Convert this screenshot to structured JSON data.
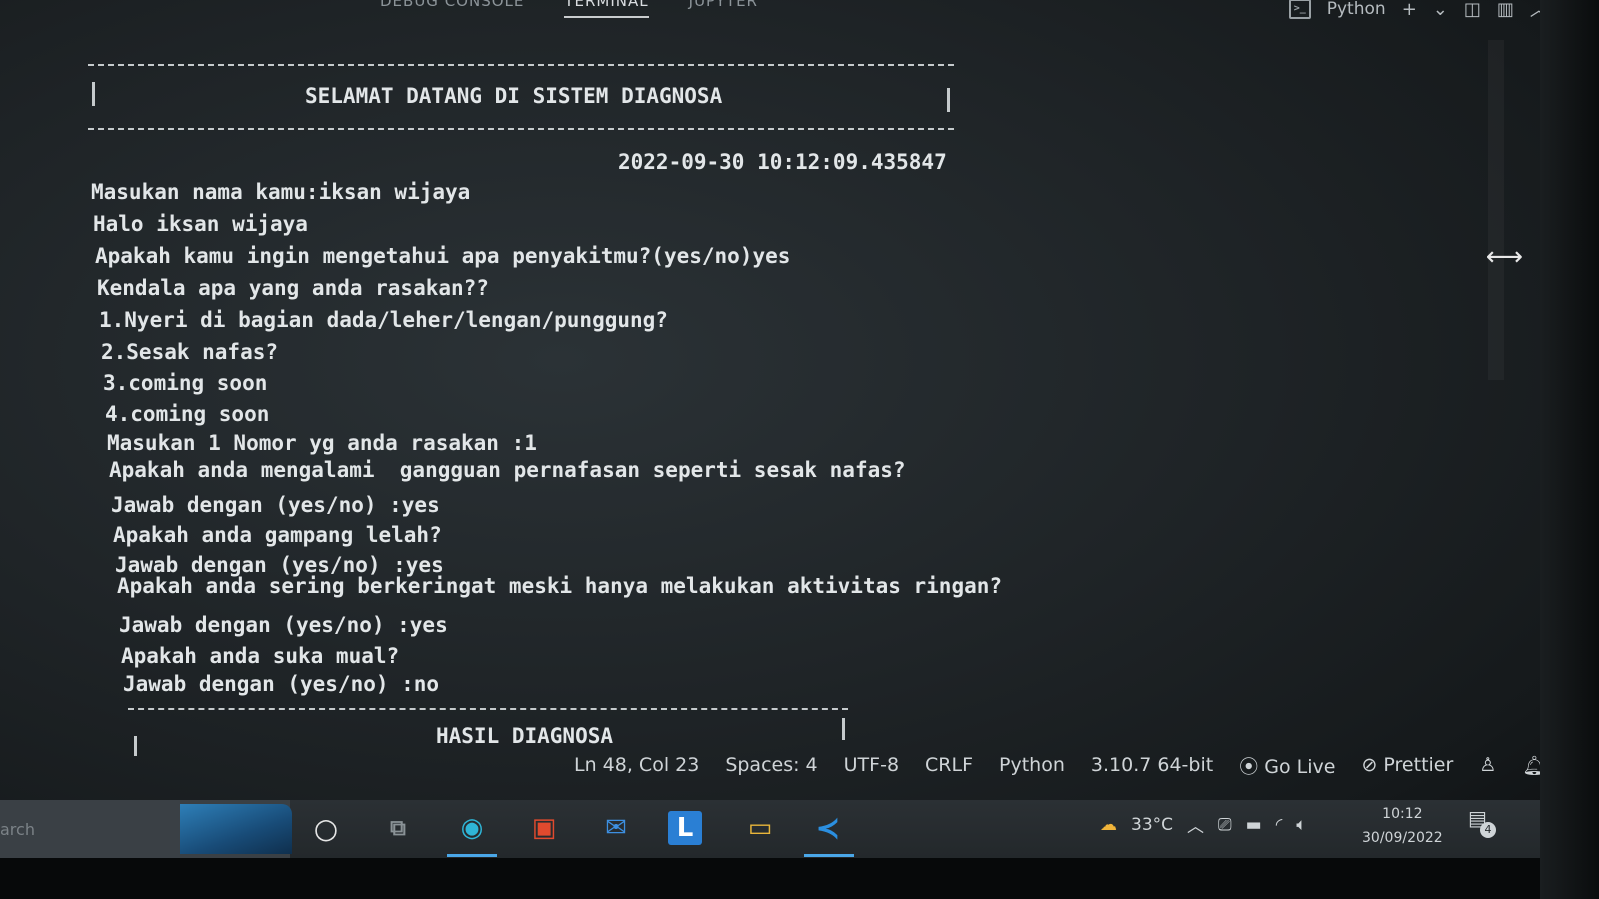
{
  "panel": {
    "tabs": [
      "DEBUG CONSOLE",
      "TERMINAL",
      "JUPYTER"
    ],
    "active_tab": "TERMINAL",
    "shell_label": "Python",
    "add_icon": "plus-icon",
    "split_icon": "split-icon",
    "trash_icon": "trash-icon"
  },
  "terminal": {
    "banner_title": "SELAMAT DATANG DI SISTEM DIAGNOSA",
    "timestamp": "2022-09-30 10:12:09.435847",
    "lines": [
      "Masukan nama kamu:iksan wijaya",
      "Halo iksan wijaya",
      "Apakah kamu ingin mengetahui apa penyakitmu?(yes/no)yes",
      "Kendala apa yang anda rasakan??",
      "1.Nyeri di bagian dada/leher/lengan/punggung?",
      "2.Sesak nafas?",
      "3.coming soon",
      "4.coming soon",
      "Masukan 1 Nomor yg anda rasakan :1",
      "Apakah anda mengalami  gangguan pernafasan seperti sesak nafas?",
      "Jawab dengan (yes/no) :yes",
      "Apakah anda gampang lelah?",
      "Jawab dengan (yes/no) :yes",
      "Apakah anda sering berkeringat meski hanya melakukan aktivitas ringan?",
      "Jawab dengan (yes/no) :yes",
      "Apakah anda suka mual?",
      "Jawab dengan (yes/no) :no"
    ],
    "result_title": "HASIL DIAGNOSA"
  },
  "terminal_list": {
    "count": 9,
    "icon": "terminal-icon"
  },
  "statusbar": {
    "position": "Ln 48, Col 23",
    "spaces": "Spaces: 4",
    "encoding": "UTF-8",
    "eol": "CRLF",
    "language": "Python",
    "interpreter": "3.10.7 64-bit",
    "go_live": "Go Live",
    "prettier": "Prettier"
  },
  "taskbar": {
    "search_placeholder": "arch",
    "weather": "33°C",
    "time": "10:12",
    "date": "30/09/2022",
    "notifications": "4"
  }
}
